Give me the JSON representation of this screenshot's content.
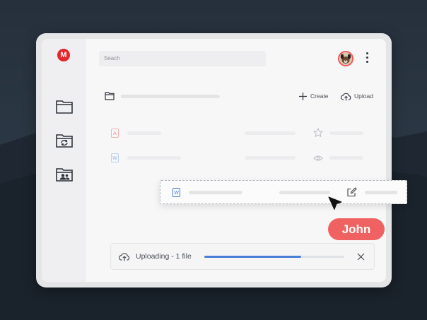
{
  "app": {
    "logo_letter": "M",
    "brand_color": "#e5262b"
  },
  "header": {
    "search_placeholder": "Seach"
  },
  "toolbar": {
    "create_label": "Create",
    "upload_label": "Upload"
  },
  "files": [
    {
      "type_letter": "A",
      "icon_color": "#f28b8b",
      "action_icon": "star-icon"
    },
    {
      "type_letter": "W",
      "icon_color": "#8fb2ea",
      "action_icon": "eye-icon"
    }
  ],
  "dragged_file": {
    "type_letter": "W",
    "icon_color": "#4a7fd6",
    "action_icon": "edit-icon"
  },
  "collaborator": {
    "name": "John",
    "color": "#f06262"
  },
  "upload": {
    "status_text": "Uploading - 1 file",
    "progress": 0.69
  }
}
